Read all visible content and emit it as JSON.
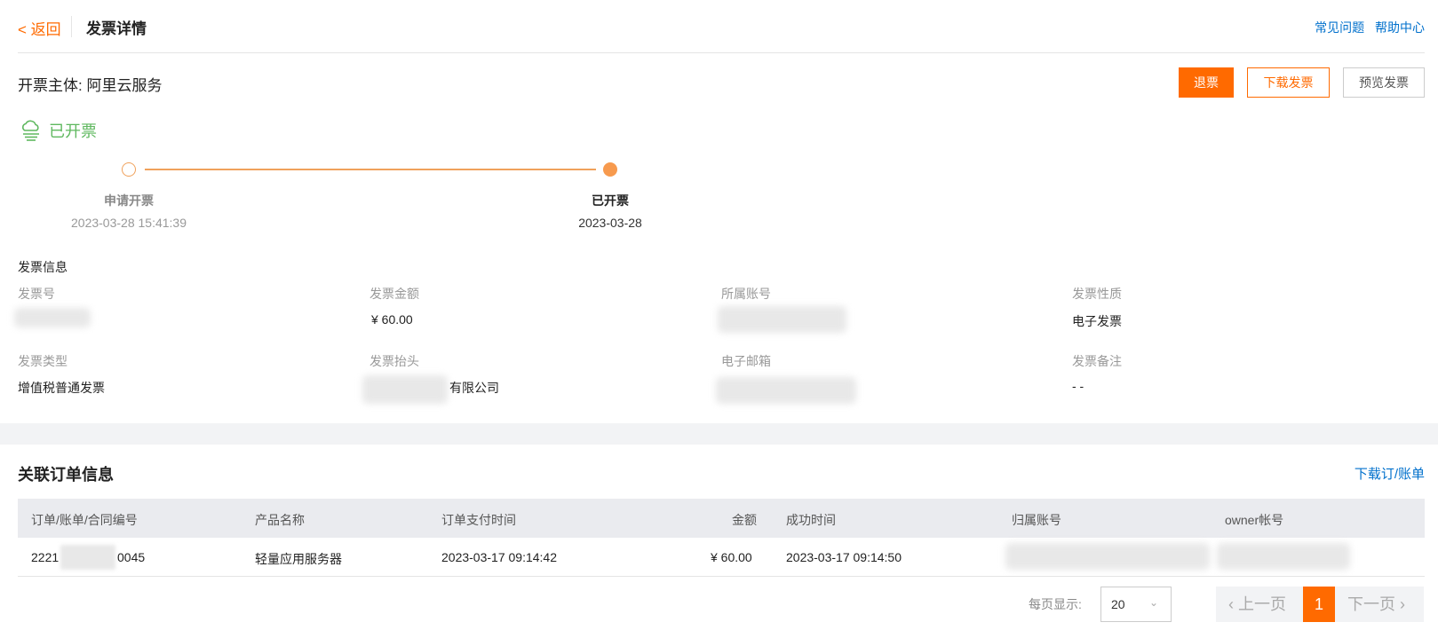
{
  "header": {
    "back_label": "< 返回",
    "title": "发票详情",
    "links": [
      "常见问题",
      "帮助中心"
    ]
  },
  "entity": {
    "label": "开票主体",
    "value": "阿里云服务"
  },
  "actions": {
    "refund_label": "退票",
    "download_label": "下载发票",
    "preview_label": "预览发票"
  },
  "status": {
    "text": "已开票",
    "color": "#5fb85f",
    "icon": "cloud-icon"
  },
  "steps": [
    {
      "title": "申请开票",
      "time": "2023-03-28 15:41:39",
      "state": "done"
    },
    {
      "title": "已开票",
      "time": "2023-03-28",
      "state": "current"
    }
  ],
  "invoice_info": {
    "section_title": "发票信息",
    "fields": {
      "invoice_no": {
        "label": "发票号",
        "value": ""
      },
      "amount": {
        "label": "发票金额",
        "value": "¥ 60.00"
      },
      "account": {
        "label": "所属账号",
        "value": ""
      },
      "nature": {
        "label": "发票性质",
        "value": "电子发票"
      },
      "type": {
        "label": "发票类型",
        "value": "增值税普通发票"
      },
      "header": {
        "label": "发票抬头",
        "value": "有限公司"
      },
      "email": {
        "label": "电子邮箱",
        "value": ""
      },
      "remark": {
        "label": "发票备注",
        "value": "- -"
      }
    }
  },
  "orders": {
    "title": "关联订单信息",
    "download_link": "下载订/账单",
    "columns": [
      "订单/账单/合同编号",
      "产品名称",
      "订单支付时间",
      "金额",
      "成功时间",
      "归属账号",
      "owner帐号"
    ],
    "rows": [
      {
        "order_no_prefix": "2221",
        "order_no_suffix": "0045",
        "product": "轻量应用服务器",
        "pay_time": "2023-03-17 09:14:42",
        "amount": "¥ 60.00",
        "success_time": "2023-03-17 09:14:50",
        "account": "",
        "owner": ""
      }
    ]
  },
  "pagination": {
    "per_page_label": "每页显示:",
    "per_page_value": "20",
    "prev_label": "上一页",
    "current_page": "1",
    "next_label": "下一页"
  },
  "colors": {
    "accent": "#ff6a00",
    "link": "#0070cc",
    "success": "#5fb85f"
  }
}
